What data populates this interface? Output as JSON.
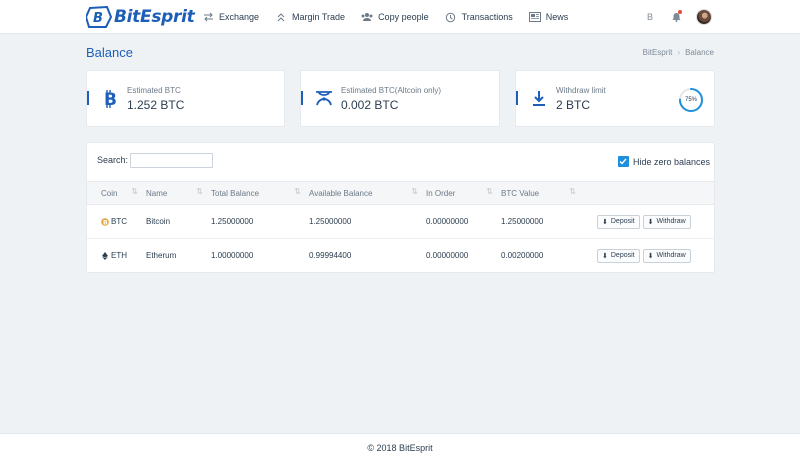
{
  "brand": {
    "name": "BitEsprit"
  },
  "nav": {
    "items": [
      {
        "label": "Exchange",
        "icon": "exchange-arrows-icon"
      },
      {
        "label": "Margin Trade",
        "icon": "double-chevron-up-icon"
      },
      {
        "label": "Copy people",
        "icon": "people-icon"
      },
      {
        "label": "Transactions",
        "icon": "history-icon"
      },
      {
        "label": "News",
        "icon": "newspaper-icon"
      }
    ]
  },
  "header_right": {
    "currency_symbol": "B",
    "icons": [
      "bitcoin-icon",
      "bell-icon",
      "avatar"
    ]
  },
  "page": {
    "title": "Balance"
  },
  "breadcrumb": {
    "items": [
      "BitEsprit",
      "Balance"
    ]
  },
  "cards": [
    {
      "label": "Estimated BTC",
      "value": "1.252 BTC",
      "icon": "bitcoin-icon"
    },
    {
      "label": "Estimated BTC(Altcoin only)",
      "value": "0.002 BTC",
      "icon": "altcoin-icon"
    },
    {
      "label": "Withdraw limit",
      "value": "2 BTC",
      "icon": "download-icon",
      "progress": {
        "label": "75%",
        "value": 0.75
      }
    }
  ],
  "table_controls": {
    "search_label": "Search:",
    "search_value": "",
    "hide_zero_label": "Hide zero balances",
    "hide_zero_checked": true
  },
  "table": {
    "columns": [
      "Coin",
      "Name",
      "Total Balance",
      "Available Balance",
      "In Order",
      "BTC Value"
    ],
    "rows": [
      {
        "coin": "BTC",
        "name": "Bitcoin",
        "total": "1.25000000",
        "available": "1.25000000",
        "in_order": "0.00000000",
        "btc_value": "1.25000000"
      },
      {
        "coin": "ETH",
        "name": "Etherum",
        "total": "1.00000000",
        "available": "0.99994400",
        "in_order": "0.00000000",
        "btc_value": "0.00200000"
      }
    ],
    "actions": {
      "deposit": "Deposit",
      "withdraw": "Withdraw"
    }
  },
  "footer": {
    "text": "© 2018 BitEsprit"
  },
  "colors": {
    "brand_blue": "#1d5fb8",
    "checkbox_blue": "#1d8fdc",
    "background": "#eef2f5",
    "notification_red": "#e74c3c"
  }
}
